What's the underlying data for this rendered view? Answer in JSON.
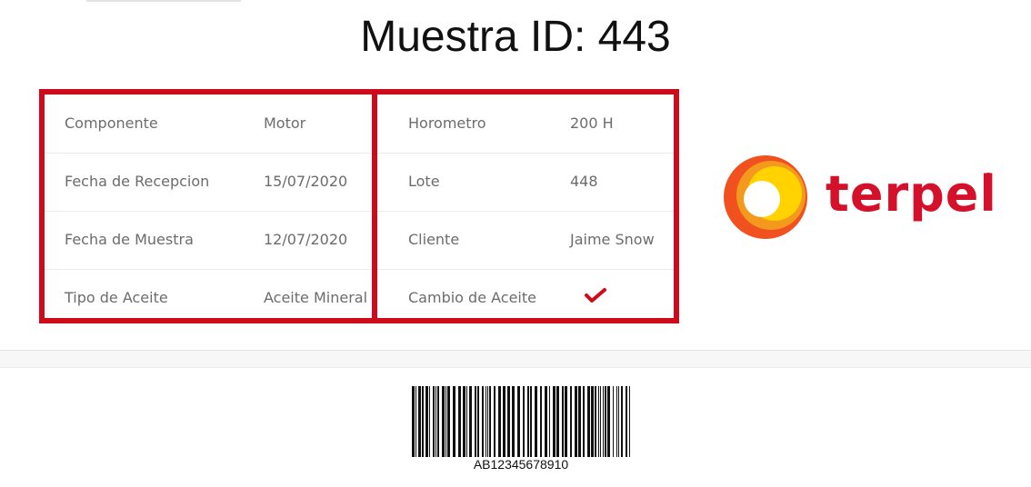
{
  "title": "Muestra ID: 443",
  "left_table": [
    {
      "label": "Componente",
      "value": "Motor"
    },
    {
      "label": "Fecha de Recepcion",
      "value": "15/07/2020"
    },
    {
      "label": "Fecha de Muestra",
      "value": "12/07/2020"
    },
    {
      "label": "Tipo de Aceite",
      "value": "Aceite Mineral"
    }
  ],
  "right_table": [
    {
      "label": "Horometro",
      "value": "200 H"
    },
    {
      "label": "Lote",
      "value": "448"
    },
    {
      "label": "Cliente",
      "value": "Jaime Snow"
    },
    {
      "label": "Cambio de Aceite",
      "value": ""
    }
  ],
  "oil_change_checked": true,
  "logo": {
    "text": "terpel",
    "registered": "®"
  },
  "barcode": {
    "code": "AB12345678910"
  },
  "colors": {
    "accent": "#cf0a1a",
    "brand_red": "#d5102a",
    "brand_orange": "#f37021",
    "brand_yellow": "#ffd200"
  }
}
